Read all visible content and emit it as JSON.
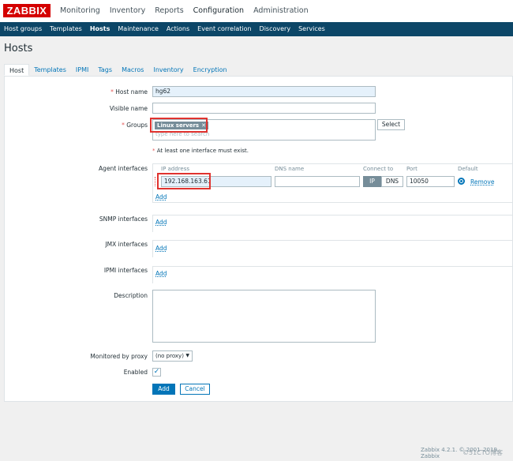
{
  "brand": "ZABBIX",
  "main_menu": [
    "Monitoring",
    "Inventory",
    "Reports",
    "Configuration",
    "Administration"
  ],
  "sub_menu": [
    "Host groups",
    "Templates",
    "Hosts",
    "Maintenance",
    "Actions",
    "Event correlation",
    "Discovery",
    "Services"
  ],
  "page_title": "Hosts",
  "tabs": [
    "Host",
    "Templates",
    "IPMI",
    "Tags",
    "Macros",
    "Inventory",
    "Encryption"
  ],
  "form": {
    "host_name_label": "Host name",
    "host_name_value": "hg62",
    "visible_name_label": "Visible name",
    "visible_name_value": "",
    "groups_label": "Groups",
    "group_chip": "Linux servers",
    "groups_placeholder": "type here to search",
    "select_button": "Select",
    "interface_notice": "At least one interface must exist.",
    "agent_label": "Agent interfaces",
    "columns": {
      "ip": "IP address",
      "dns": "DNS name",
      "connect": "Connect to",
      "port": "Port",
      "default": "Default"
    },
    "ip_value": "192.168.163.61",
    "dns_value": "",
    "connect_ip": "IP",
    "connect_dns": "DNS",
    "port_value": "10050",
    "remove_link": "Remove",
    "add_link": "Add",
    "snmp_label": "SNMP interfaces",
    "jmx_label": "JMX interfaces",
    "ipmi_label": "IPMI interfaces",
    "description_label": "Description",
    "proxy_label": "Monitored by proxy",
    "proxy_value": "(no proxy)",
    "enabled_label": "Enabled",
    "add_button": "Add",
    "cancel_button": "Cancel"
  },
  "footer": "Zabbix 4.2.1. © 2001–2019, Zabbix",
  "watermark": "©51CTO博客",
  "colors": {
    "brand_red": "#d40000",
    "nav_blue": "#0c4667",
    "link_blue": "#0275b8",
    "highlight_red": "#e0332f"
  }
}
